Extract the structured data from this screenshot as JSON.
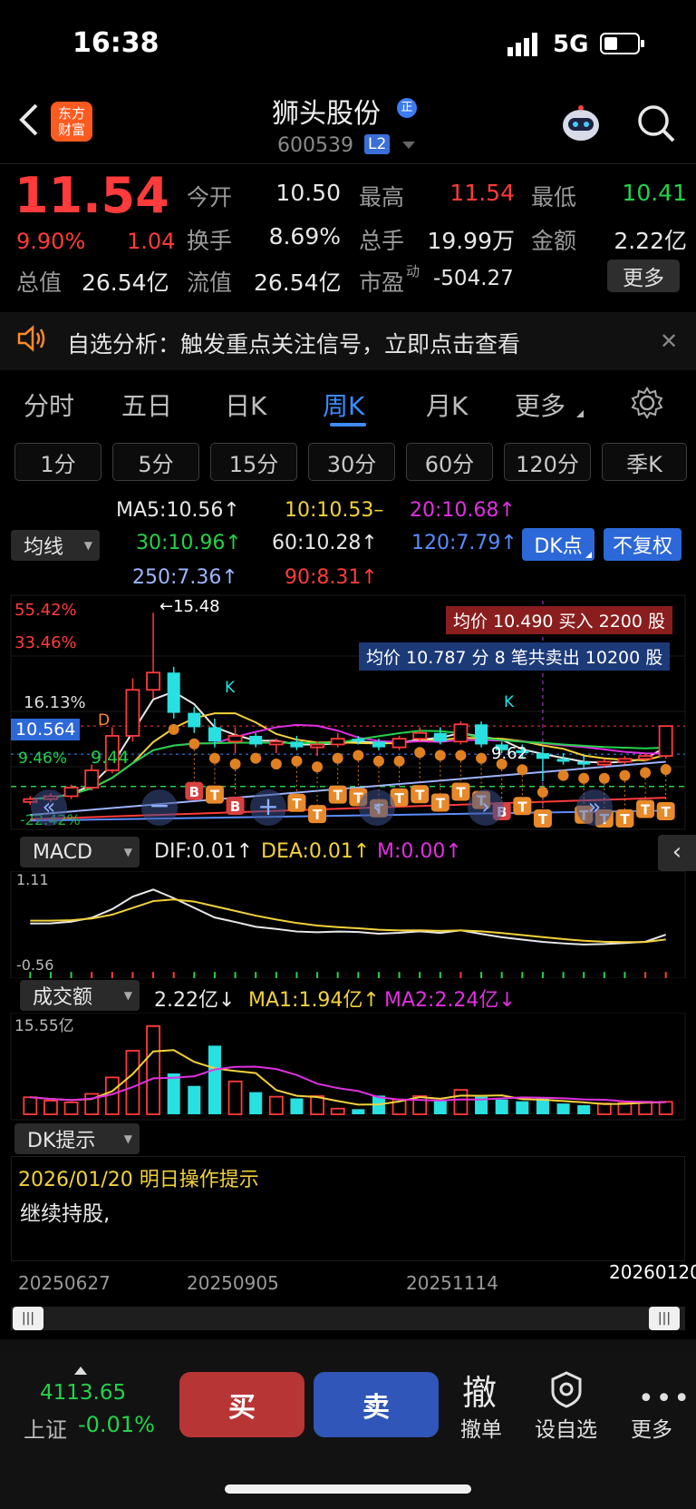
{
  "status": {
    "time": "16:38",
    "network": "5G"
  },
  "header": {
    "stock_name": "狮头股份",
    "badge": "正",
    "code": "600539",
    "level": "L2",
    "logo": "东方\n财富"
  },
  "quote": {
    "price": "11.54",
    "change_pct": "9.90%",
    "change": "1.04",
    "rows": [
      [
        {
          "label": "今开",
          "value": "10.50",
          "color": "white"
        },
        {
          "label": "最高",
          "value": "11.54",
          "color": "red"
        },
        {
          "label": "最低",
          "value": "10.41",
          "color": "green"
        }
      ],
      [
        {
          "label": "换手",
          "value": "8.69%",
          "color": "white"
        },
        {
          "label": "总手",
          "value": "19.99万",
          "color": "white"
        },
        {
          "label": "金额",
          "value": "2.22亿",
          "color": "white"
        }
      ]
    ],
    "total_value_label": "总值",
    "total_value": "26.54亿",
    "float_label": "流值",
    "float_value": "26.54亿",
    "pe_label": "市盈",
    "pe_sup": "动",
    "pe_value": "-504.27",
    "more_button": "更多"
  },
  "notice": {
    "text": "自选分析：触发重点关注信号，立即点击查看"
  },
  "chart_tabs": [
    "分时",
    "五日",
    "日K",
    "周K",
    "月K",
    "更多"
  ],
  "active_tab": "周K",
  "periods": [
    "1分",
    "5分",
    "15分",
    "30分",
    "60分",
    "120分",
    "季K"
  ],
  "ma_select": "均线",
  "ma_values": {
    "ma5": "MA5:10.56↑",
    "ma10": "10:10.53–",
    "ma20": "20:10.68↑",
    "ma30": "30:10.96↑",
    "ma60": "60:10.28↑",
    "ma120": "120:7.79↑",
    "ma250": "250:7.36↑",
    "ma90": "90:8.31↑"
  },
  "buttons": {
    "dk_point": "DK点",
    "no_adjust": "不复权"
  },
  "kline": {
    "pct_top": "55.42%",
    "pct_2": "33.46%",
    "pct_3": "16.13%",
    "pct_bottom": "-22.42%",
    "high_mark": "←15.48",
    "price_tag": "10.564",
    "level_944": "9.44",
    "label_946": "9.46%",
    "low_mark": "9.62",
    "buy_info": "均价 10.490 买入 2200 股",
    "sell_info": "均价 10.787 分 8 笔共卖出 10200 股",
    "k_marks": [
      "K",
      "K"
    ],
    "d_mark": "D"
  },
  "macd": {
    "select": "MACD",
    "dif": "DIF:0.01↑",
    "dea": "DEA:0.01↑",
    "m": "M:0.00↑",
    "top": "1.11",
    "bottom": "-0.56"
  },
  "volume": {
    "select": "成交额",
    "value": "2.22亿↓",
    "ma1": "MA1:1.94亿↑",
    "ma2": "MA2:2.24亿↓",
    "top": "15.55亿"
  },
  "dk": {
    "select": "DK提示",
    "date_line": "2026/01/20 明日操作提示",
    "advice": "继续持股,"
  },
  "dates": [
    "20250627",
    "20250905",
    "20251114",
    "20260120"
  ],
  "index": {
    "value": "4113.65",
    "name": "上证",
    "change": "-0.01%"
  },
  "actions": {
    "buy": "买",
    "sell": "卖",
    "cancel_icon": "撤",
    "cancel": "撤单",
    "watch": "设自选",
    "more": "更多"
  },
  "colors": {
    "up": "#ff3b3b",
    "down": "#28e0e0",
    "accent": "#3d8bff",
    "buy_btn": "#b83535",
    "sell_btn": "#2f56b8"
  },
  "chart_data": {
    "type": "candlestick",
    "candles": [
      [
        8.9,
        9.1,
        8.8,
        9.0
      ],
      [
        9.0,
        9.2,
        8.9,
        9.1
      ],
      [
        9.1,
        9.5,
        9.0,
        9.4
      ],
      [
        9.4,
        10.2,
        9.3,
        10.0
      ],
      [
        10.0,
        11.5,
        9.9,
        11.2
      ],
      [
        11.2,
        13.2,
        11.0,
        12.8
      ],
      [
        12.8,
        15.48,
        12.5,
        13.4
      ],
      [
        13.4,
        13.6,
        11.8,
        12.0
      ],
      [
        12.0,
        12.2,
        11.3,
        11.5
      ],
      [
        11.5,
        11.8,
        10.8,
        11.0
      ],
      [
        11.0,
        11.5,
        10.6,
        11.2
      ],
      [
        11.2,
        11.3,
        10.8,
        10.9
      ],
      [
        10.9,
        11.1,
        10.6,
        11.0
      ],
      [
        11.0,
        11.2,
        10.7,
        10.8
      ],
      [
        10.8,
        11.0,
        10.5,
        10.9
      ],
      [
        10.9,
        11.3,
        10.8,
        11.1
      ],
      [
        11.1,
        11.2,
        10.9,
        11.0
      ],
      [
        11.0,
        11.1,
        10.7,
        10.8
      ],
      [
        10.8,
        11.2,
        10.7,
        11.1
      ],
      [
        11.1,
        11.5,
        11.0,
        11.3
      ],
      [
        11.3,
        11.5,
        10.9,
        11.0
      ],
      [
        11.0,
        11.7,
        10.9,
        11.6
      ],
      [
        11.6,
        11.7,
        10.8,
        10.9
      ],
      [
        10.9,
        11.0,
        10.6,
        10.7
      ],
      [
        10.7,
        10.9,
        10.4,
        10.6
      ],
      [
        10.6,
        10.8,
        9.62,
        10.4
      ],
      [
        10.4,
        10.6,
        10.2,
        10.3
      ],
      [
        10.3,
        10.5,
        10.1,
        10.2
      ],
      [
        10.2,
        10.4,
        10.1,
        10.3
      ],
      [
        10.3,
        10.5,
        10.2,
        10.4
      ],
      [
        10.4,
        10.6,
        10.3,
        10.5
      ],
      [
        10.5,
        11.54,
        10.41,
        11.54
      ]
    ],
    "volume_yi": [
      3.0,
      2.4,
      2.1,
      3.6,
      6.5,
      11.2,
      15.55,
      7.2,
      5.0,
      12.1,
      5.8,
      3.9,
      3.1,
      2.8,
      3.2,
      1.0,
      0.9,
      3.3,
      2.6,
      3.2,
      2.4,
      4.3,
      3.1,
      2.6,
      2.3,
      2.8,
      1.9,
      1.6,
      1.9,
      2.0,
      2.22,
      2.2
    ],
    "macd_range": [
      -0.56,
      1.11
    ]
  }
}
